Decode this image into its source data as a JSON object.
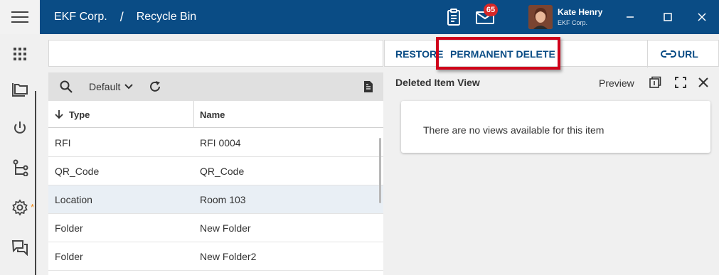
{
  "header": {
    "company": "EKF Corp.",
    "separator": "/",
    "page": "Recycle Bin",
    "mail_badge": "65",
    "user_name": "Kate Henry",
    "user_org": "EKF Corp."
  },
  "toolbar": {
    "view_select": "Default"
  },
  "grid": {
    "columns": [
      "Type",
      "Name"
    ],
    "rows": [
      {
        "type": "RFI",
        "name": "RFI 0004",
        "selected": false
      },
      {
        "type": "QR_Code",
        "name": "QR_Code",
        "selected": false
      },
      {
        "type": "Location",
        "name": "Room 103",
        "selected": true
      },
      {
        "type": "Folder",
        "name": "New Folder",
        "selected": false
      },
      {
        "type": "Folder",
        "name": "New Folder2",
        "selected": false
      }
    ]
  },
  "actions": {
    "restore": "RESTORE",
    "permanent_delete": "PERMANENT DELETE",
    "url": "URL"
  },
  "detail": {
    "title": "Deleted Item View",
    "preview": "Preview",
    "empty_message": "There are no views available for this item"
  },
  "colors": {
    "header_bg": "#0a4c85",
    "accent": "#0a4c85",
    "highlight_border": "#d0021b",
    "selected_row": "#e9eff5"
  }
}
